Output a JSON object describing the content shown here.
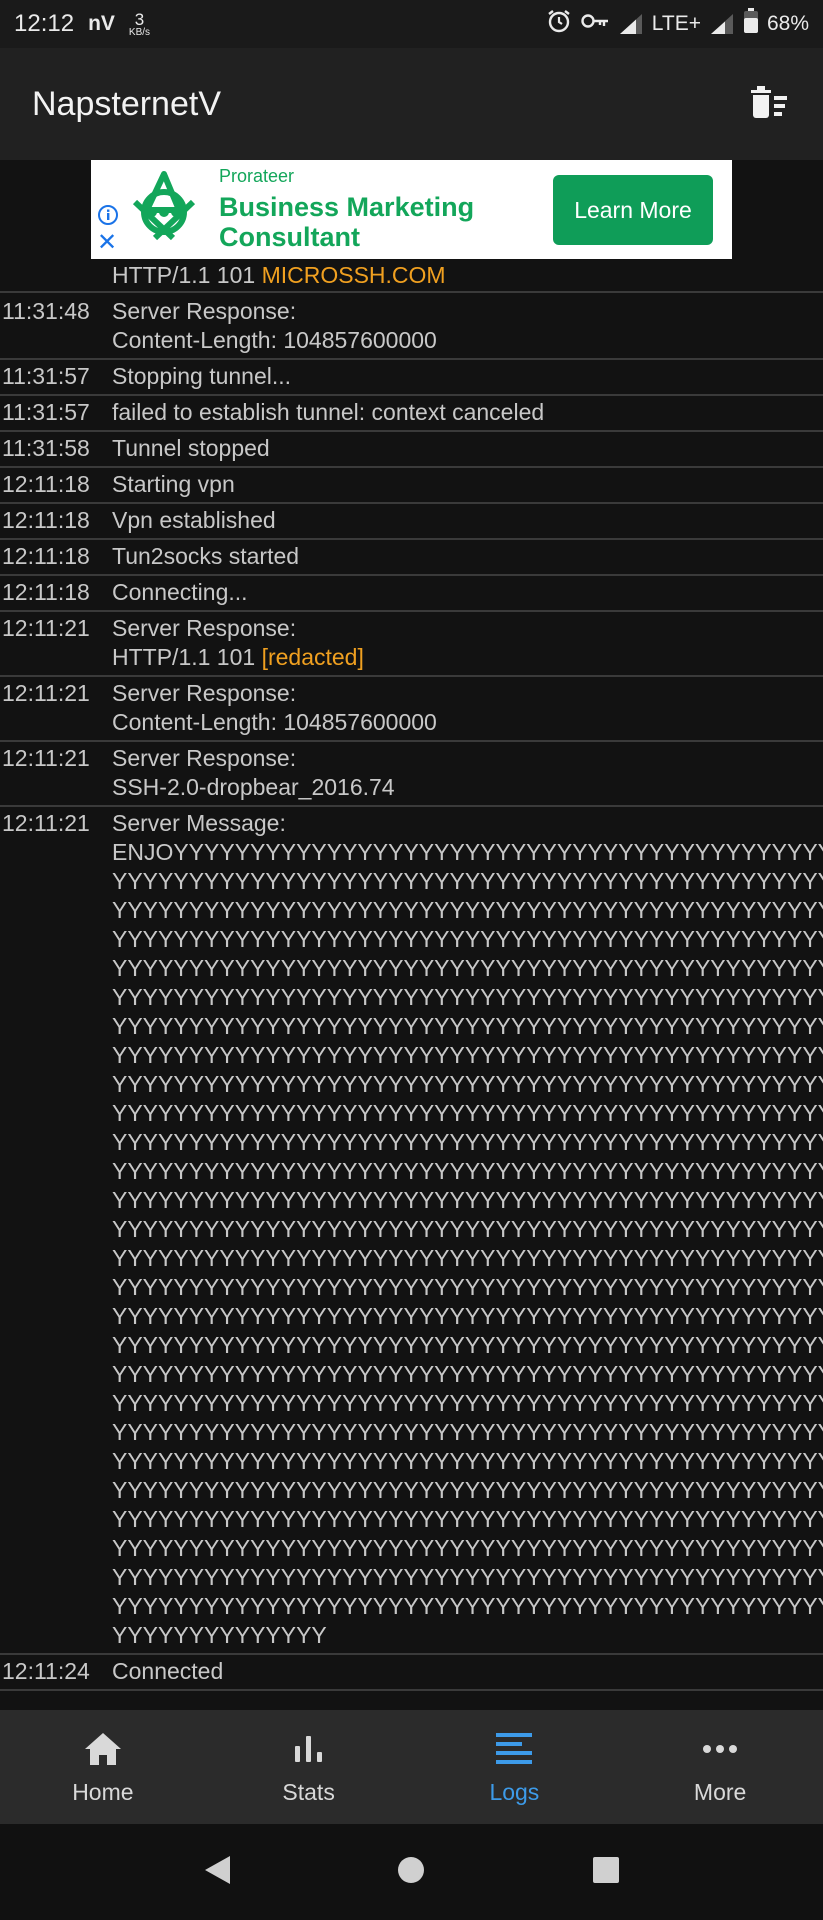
{
  "status_bar": {
    "time": "12:12",
    "carrier_mark": "nV",
    "speed_value": "3",
    "speed_unit": "KB/s",
    "network": "LTE+",
    "battery": "68%"
  },
  "app_bar": {
    "title": "NapsternetV",
    "clear_icon": "delete-sweep-icon"
  },
  "ad": {
    "brand": "Prorateer",
    "title_line1": "Business Marketing",
    "title_line2": "Consultant",
    "cta": "Learn More",
    "accent": "#0f9d58"
  },
  "logs": {
    "partial_top": {
      "prefix": "HTTP/1.1 101 ",
      "highlight": "MICROSSH.COM"
    },
    "entries": [
      {
        "time": "11:31:48",
        "lines": [
          "Server Response:",
          "Content-Length: 104857600000"
        ]
      },
      {
        "time": "11:31:57",
        "lines": [
          "Stopping tunnel..."
        ]
      },
      {
        "time": "11:31:57",
        "lines": [
          "failed to establish tunnel: context canceled"
        ]
      },
      {
        "time": "11:31:58",
        "lines": [
          "Tunnel stopped"
        ]
      },
      {
        "time": "12:11:18",
        "lines": [
          "Starting vpn"
        ]
      },
      {
        "time": "12:11:18",
        "lines": [
          "Vpn established"
        ]
      },
      {
        "time": "12:11:18",
        "lines": [
          "Tun2socks started"
        ]
      },
      {
        "time": "12:11:18",
        "lines": [
          "Connecting..."
        ]
      },
      {
        "time": "12:11:21",
        "lines": [
          "Server Response:"
        ],
        "highlight_line": {
          "prefix": "HTTP/1.1 101 ",
          "highlight": "[redacted]"
        }
      },
      {
        "time": "12:11:21",
        "lines": [
          "Server Response:",
          "Content-Length: 104857600000"
        ]
      },
      {
        "time": "12:11:21",
        "lines": [
          "Server Response:",
          "SSH-2.0-dropbear_2016.74"
        ]
      },
      {
        "time": "12:11:21",
        "lines": [
          "Server Message:",
          "ENJOYYYYYYYYYYYYYYYYYYYYYYYYYYYYYYYYYYYYYYYYYYYYYYYY",
          "YYYYYYYYYYYYYYYYYYYYYYYYYYYYYYYYYYYYYYYYYYYYYYYYYYYYY",
          "YYYYYYYYYYYYYYYYYYYYYYYYYYYYYYYYYYYYYYYYYYYYYYYYYYYYY",
          "YYYYYYYYYYYYYYYYYYYYYYYYYYYYYYYYYYYYYYYYYYYYYYYYYYYYY",
          "YYYYYYYYYYYYYYYYYYYYYYYYYYYYYYYYYYYYYYYYYYYYYYYYYYYYY",
          "YYYYYYYYYYYYYYYYYYYYYYYYYYYYYYYYYYYYYYYYYYYYYYYYYYYYY",
          "YYYYYYYYYYYYYYYYYYYYYYYYYYYYYYYYYYYYYYYYYYYYYYYYYYYYY",
          "YYYYYYYYYYYYYYYYYYYYYYYYYYYYYYYYYYYYYYYYYYYYYYYYYYYYY",
          "YYYYYYYYYYYYYYYYYYYYYYYYYYYYYYYYYYYYYYYYYYYYYYYYYYYYY",
          "YYYYYYYYYYYYYYYYYYYYYYYYYYYYYYYYYYYYYYYYYYYYYYYYYYYYY",
          "YYYYYYYYYYYYYYYYYYYYYYYYYYYYYYYYYYYYYYYYYYYYYYYYYYYYY",
          "YYYYYYYYYYYYYYYYYYYYYYYYYYYYYYYYYYYYYYYYYYYYYYYYYYYYY",
          "YYYYYYYYYYYYYYYYYYYYYYYYYYYYYYYYYYYYYYYYYYYYYYYYYYYYY",
          "YYYYYYYYYYYYYYYYYYYYYYYYYYYYYYYYYYYYYYYYYYYYYYYYYYYYY",
          "YYYYYYYYYYYYYYYYYYYYYYYYYYYYYYYYYYYYYYYYYYYYYYYYYYYYY",
          "YYYYYYYYYYYYYYYYYYYYYYYYYYYYYYYYYYYYYYYYYYYYYYYYYYYYY",
          "YYYYYYYYYYYYYYYYYYYYYYYYYYYYYYYYYYYYYYYYYYYYYYYYYYYYY",
          "YYYYYYYYYYYYYYYYYYYYYYYYYYYYYYYYYYYYYYYYYYYYYYYYYYYYY",
          "YYYYYYYYYYYYYYYYYYYYYYYYYYYYYYYYYYYYYYYYYYYYYYYYYYYYY",
          "YYYYYYYYYYYYYYYYYYYYYYYYYYYYYYYYYYYYYYYYYYYYYYYYYYYYY",
          "YYYYYYYYYYYYYYYYYYYYYYYYYYYYYYYYYYYYYYYYYYYYYYYYYYYYY",
          "YYYYYYYYYYYYYYYYYYYYYYYYYYYYYYYYYYYYYYYYYYYYYYYYYYYYY",
          "YYYYYYYYYYYYYYYYYYYYYYYYYYYYYYYYYYYYYYYYYYYYYYYYYYYYY",
          "YYYYYYYYYYYYYYYYYYYYYYYYYYYYYYYYYYYYYYYYYYYYYYYYYYYYY",
          "YYYYYYYYYYYYYYYYYYYYYYYYYYYYYYYYYYYYYYYYYYYYYYYYYYYYY",
          "YYYYYYYYYYYYYYYYYYYYYYYYYYYYYYYYYYYYYYYYYYYYYYYYYYYYY",
          "YYYYYYYYYYYYYYYYYYYYYYYYYYYYYYYYYYYYYYYYYYYYYYYYYYYYY",
          "YYYYYYYYYYYYYY"
        ]
      },
      {
        "time": "12:11:24",
        "lines": [
          "Connected"
        ]
      }
    ],
    "highlight_color": "#f0a020"
  },
  "bottom_nav": {
    "items": [
      {
        "label": "Home",
        "icon": "home-icon",
        "active": false
      },
      {
        "label": "Stats",
        "icon": "bar-chart-icon",
        "active": false
      },
      {
        "label": "Logs",
        "icon": "logs-list-icon",
        "active": true
      },
      {
        "label": "More",
        "icon": "more-dots-icon",
        "active": false
      }
    ],
    "active_color": "#3d9be9"
  },
  "system_nav": {
    "back_icon": "back-triangle-icon",
    "home_icon": "home-circle-icon",
    "recents_icon": "recents-square-icon"
  }
}
